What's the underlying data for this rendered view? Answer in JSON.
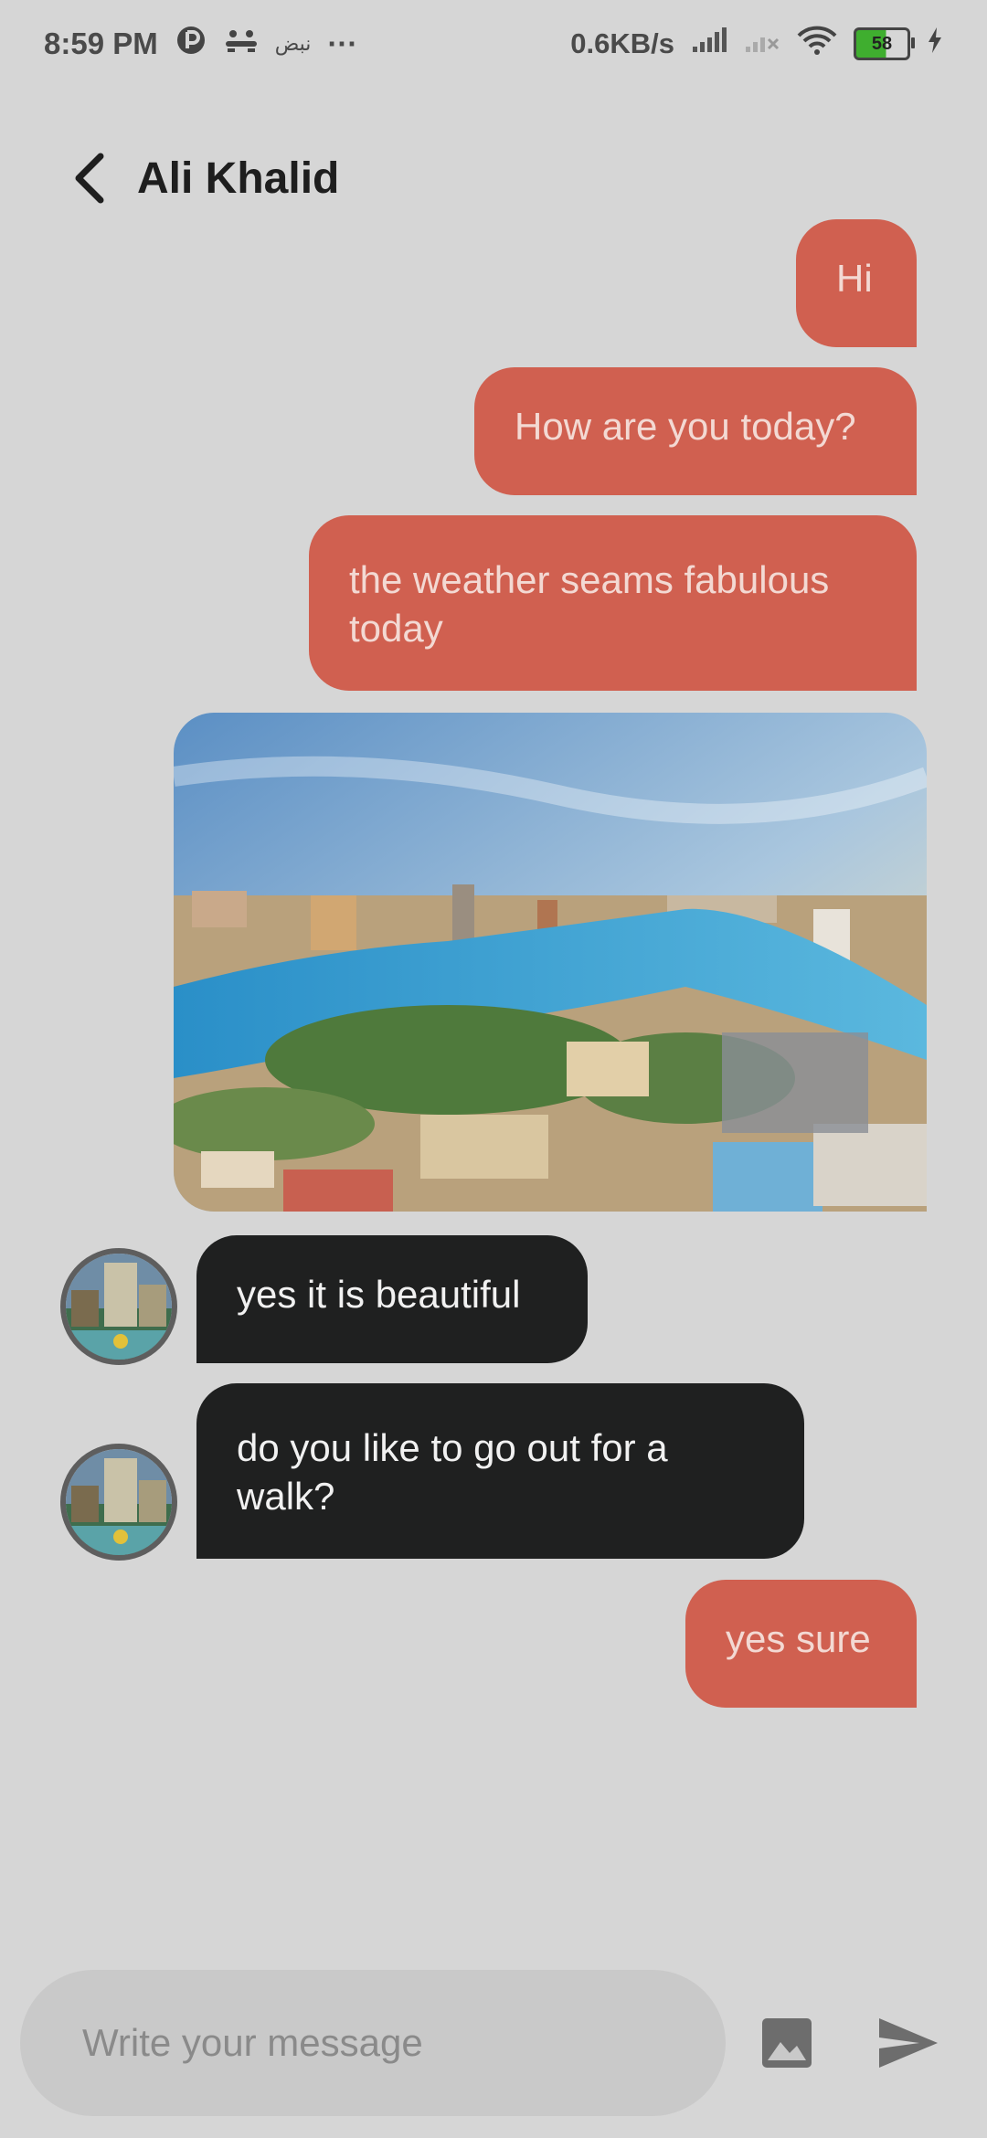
{
  "status_bar": {
    "time": "8:59 PM",
    "arabic_label": "نبض",
    "more": "···",
    "net_speed": "0.6KB/s",
    "battery": "58"
  },
  "header": {
    "contact_name": "Ali Khalid",
    "back_icon": "chevron-left-icon"
  },
  "messages": [
    {
      "direction": "out",
      "type": "text",
      "text": "Hi"
    },
    {
      "direction": "out",
      "type": "text",
      "text": "How are you today?"
    },
    {
      "direction": "out",
      "type": "text",
      "text": "the weather seams fabulous today"
    },
    {
      "direction": "out",
      "type": "image"
    },
    {
      "direction": "in",
      "type": "text",
      "text": "yes it is beautiful"
    },
    {
      "direction": "in",
      "type": "text",
      "text": "do you like to go out for a walk?"
    },
    {
      "direction": "out",
      "type": "text",
      "text": "yes sure"
    }
  ],
  "composer": {
    "placeholder": "Write your message",
    "image_icon": "image-icon",
    "send_icon": "send-icon"
  },
  "colors": {
    "background": "#d6d6d6",
    "outgoing_bubble": "#d06050",
    "incoming_bubble": "#1f2020",
    "composer": "#c9c9c9"
  }
}
